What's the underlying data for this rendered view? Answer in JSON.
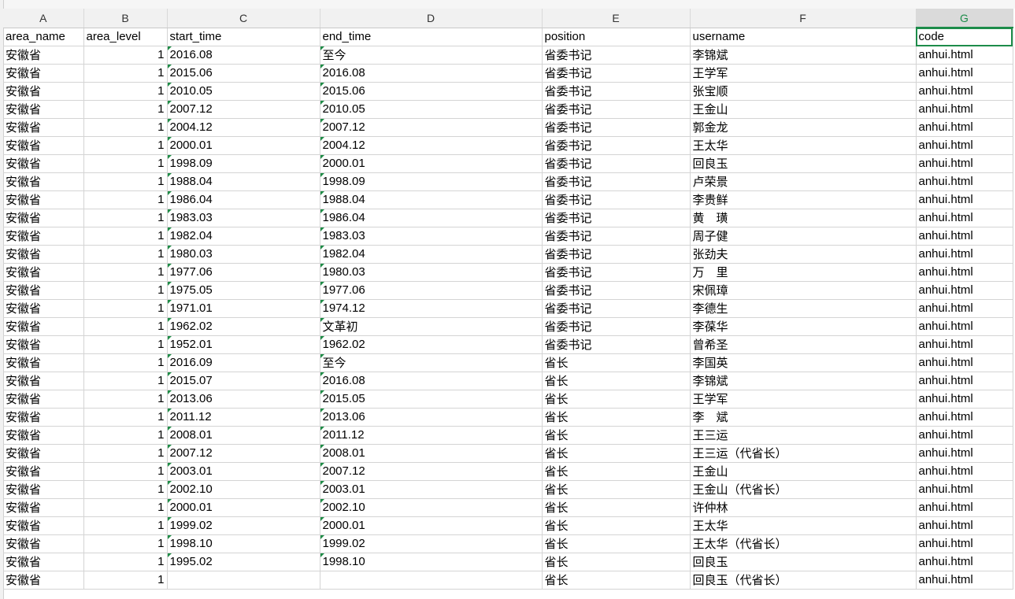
{
  "columns": [
    "A",
    "B",
    "C",
    "D",
    "E",
    "F",
    "G"
  ],
  "active_column": "G",
  "header_row": [
    "area_name",
    "area_level",
    "start_time",
    "end_time",
    "position",
    "username",
    "code"
  ],
  "rows": [
    [
      "安徽省",
      "1",
      "2016.08",
      "至今",
      "省委书记",
      "李锦斌",
      "anhui.html"
    ],
    [
      "安徽省",
      "1",
      "2015.06",
      "2016.08",
      "省委书记",
      "王学军",
      "anhui.html"
    ],
    [
      "安徽省",
      "1",
      "2010.05",
      "2015.06",
      "省委书记",
      "张宝顺",
      "anhui.html"
    ],
    [
      "安徽省",
      "1",
      "2007.12",
      "2010.05",
      "省委书记",
      "王金山",
      "anhui.html"
    ],
    [
      "安徽省",
      "1",
      "2004.12",
      "2007.12",
      "省委书记",
      "郭金龙",
      "anhui.html"
    ],
    [
      "安徽省",
      "1",
      "2000.01",
      "2004.12",
      "省委书记",
      "王太华",
      "anhui.html"
    ],
    [
      "安徽省",
      "1",
      "1998.09",
      "2000.01",
      "省委书记",
      "回良玉",
      "anhui.html"
    ],
    [
      "安徽省",
      "1",
      "1988.04",
      "1998.09",
      "省委书记",
      "卢荣景",
      "anhui.html"
    ],
    [
      "安徽省",
      "1",
      "1986.04",
      "1988.04",
      "省委书记",
      "李贵鲜",
      "anhui.html"
    ],
    [
      "安徽省",
      "1",
      "1983.03",
      "1986.04",
      "省委书记",
      "黄　璜",
      "anhui.html"
    ],
    [
      "安徽省",
      "1",
      "1982.04",
      "1983.03",
      "省委书记",
      "周子健",
      "anhui.html"
    ],
    [
      "安徽省",
      "1",
      "1980.03",
      "1982.04",
      "省委书记",
      "张劲夫",
      "anhui.html"
    ],
    [
      "安徽省",
      "1",
      "1977.06",
      "1980.03",
      "省委书记",
      "万　里",
      "anhui.html"
    ],
    [
      "安徽省",
      "1",
      "1975.05",
      "1977.06",
      "省委书记",
      "宋佩璋",
      "anhui.html"
    ],
    [
      "安徽省",
      "1",
      "1971.01",
      "1974.12",
      "省委书记",
      "李德生",
      "anhui.html"
    ],
    [
      "安徽省",
      "1",
      "1962.02",
      "文革初",
      "省委书记",
      "李葆华",
      "anhui.html"
    ],
    [
      "安徽省",
      "1",
      "1952.01",
      "1962.02",
      "省委书记",
      "曾希圣",
      "anhui.html"
    ],
    [
      "安徽省",
      "1",
      "2016.09",
      "至今",
      "省长",
      "李国英",
      "anhui.html"
    ],
    [
      "安徽省",
      "1",
      "2015.07",
      "2016.08",
      "省长",
      "李锦斌",
      "anhui.html"
    ],
    [
      "安徽省",
      "1",
      "2013.06",
      "2015.05",
      "省长",
      "王学军",
      "anhui.html"
    ],
    [
      "安徽省",
      "1",
      "2011.12",
      "2013.06",
      "省长",
      "李　斌",
      "anhui.html"
    ],
    [
      "安徽省",
      "1",
      "2008.01",
      "2011.12",
      "省长",
      "王三运",
      "anhui.html"
    ],
    [
      "安徽省",
      "1",
      "2007.12",
      "2008.01",
      "省长",
      "王三运（代省长）",
      "anhui.html"
    ],
    [
      "安徽省",
      "1",
      "2003.01",
      "2007.12",
      "省长",
      "王金山",
      "anhui.html"
    ],
    [
      "安徽省",
      "1",
      "2002.10",
      "2003.01",
      "省长",
      "王金山（代省长）",
      "anhui.html"
    ],
    [
      "安徽省",
      "1",
      "2000.01",
      "2002.10",
      "省长",
      "许仲林",
      "anhui.html"
    ],
    [
      "安徽省",
      "1",
      "1999.02",
      "2000.01",
      "省长",
      "王太华",
      "anhui.html"
    ],
    [
      "安徽省",
      "1",
      "1998.10",
      "1999.02",
      "省长",
      "王太华（代省长）",
      "anhui.html"
    ],
    [
      "安徽省",
      "1",
      "1995.02",
      "1998.10",
      "省长",
      "回良玉",
      "anhui.html"
    ],
    [
      "安徽省",
      "1",
      "",
      "",
      "省长",
      "回良玉（代省长）",
      "anhui.html"
    ]
  ],
  "colors": {
    "accent": "#1d8c4a",
    "grid": "#d4d4d4",
    "header_bg": "#f1f1f1"
  }
}
